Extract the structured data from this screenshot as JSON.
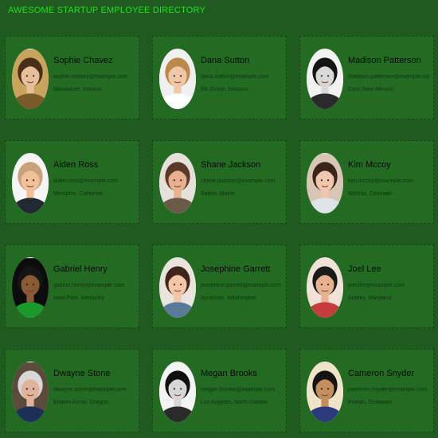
{
  "page": {
    "title": "AWESOME STARTUP EMPLOYEE DIRECTORY"
  },
  "employees": [
    {
      "name": "Sophie Chavez",
      "email": "sophie.chavez@example.com",
      "location": "Milwaukee, Indiana",
      "photo": "sophie-chavez-photo",
      "palette": {
        "bg": "#c9a45c",
        "skin": "#e7bf9a",
        "hair": "#4a2e1c",
        "shirt": "#7a5a2a"
      }
    },
    {
      "name": "Dana Sutton",
      "email": "dana.sutton@example.com",
      "location": "Elk Grove, Missouri",
      "photo": "dana-sutton-photo",
      "palette": {
        "bg": "#f0f0f0",
        "skin": "#f1c8a6",
        "hair": "#b98a4a",
        "shirt": "#ffffff"
      }
    },
    {
      "name": "Madison Patterson",
      "email": "madison.patterson@example.com",
      "location": "Cary, New Mexico",
      "photo": "madison-patterson-photo",
      "palette": {
        "bg": "#f2f2f2",
        "skin": "#d8d8d8",
        "hair": "#141414",
        "shirt": "#2a2a2a"
      }
    },
    {
      "name": "Aiden Ross",
      "email": "aiden.ross@example.com",
      "location": "Memphis, California",
      "photo": "aiden-ross-photo",
      "palette": {
        "bg": "#f5f5f5",
        "skin": "#f0c09a",
        "hair": "#c8a27a",
        "shirt": "#1f2a33"
      }
    },
    {
      "name": "Shane Jackson",
      "email": "shane.jackson@example.com",
      "location": "Salem, Maine",
      "photo": "shane-jackson-photo",
      "palette": {
        "bg": "#e5e0da",
        "skin": "#e7b08f",
        "hair": "#5a3a26",
        "shirt": "#6b5a4a"
      }
    },
    {
      "name": "Kim Mccoy",
      "email": "kim.mccoy@example.com",
      "location": "Wichita, Colorado",
      "photo": "kim-mccoy-photo",
      "palette": {
        "bg": "#d8c5b3",
        "skin": "#f0c7ad",
        "hair": "#3a2318",
        "shirt": "#dfe4ea"
      }
    },
    {
      "name": "Gabriel Henry",
      "email": "gabriel.henry@example.com",
      "location": "Iowa Park, Kentucky",
      "photo": "gabriel-henry-photo",
      "palette": {
        "bg": "#0c0c0c",
        "skin": "#8a5a34",
        "hair": "#151515",
        "shirt": "#1a9a2a"
      }
    },
    {
      "name": "Josephine Garrett",
      "email": "josephine.garrett@example.com",
      "location": "Syracuse, Washington",
      "photo": "josephine-garrett-photo",
      "palette": {
        "bg": "#e9e4dd",
        "skin": "#f1c7a8",
        "hair": "#3f2418",
        "shirt": "#5a7a9a"
      }
    },
    {
      "name": "Joel Lee",
      "email": "joel.lee@example.com",
      "location": "Aubrey, Maryland",
      "photo": "joel-lee-photo",
      "palette": {
        "bg": "#f1e2d7",
        "skin": "#e5b18f",
        "hair": "#1a1a1a",
        "shirt": "#c43c3c"
      }
    },
    {
      "name": "Dwayne Stone",
      "email": "dwayne.stone@example.com",
      "location": "Broken Arrow, Oregon",
      "photo": "dwayne-stone-photo",
      "palette": {
        "bg": "#5c4a3a",
        "skin": "#e0b39a",
        "hair": "#d7d7d7",
        "shirt": "#1c2f5a"
      }
    },
    {
      "name": "Megan Brooks",
      "email": "megan.brooks@example.com",
      "location": "Los Angeles, North Dakota",
      "photo": "megan-brooks-photo",
      "palette": {
        "bg": "#f4f4f4",
        "skin": "#d6d6d6",
        "hair": "#101010",
        "shirt": "#2a2a2a"
      }
    },
    {
      "name": "Cameron Snyder",
      "email": "cameron.snyder@example.com",
      "location": "Pueblo, Delaware",
      "photo": "cameron-snyder-photo",
      "palette": {
        "bg": "#efe3c8",
        "skin": "#c58e5d",
        "hair": "#141414",
        "shirt": "#2a3a7a"
      }
    }
  ]
}
